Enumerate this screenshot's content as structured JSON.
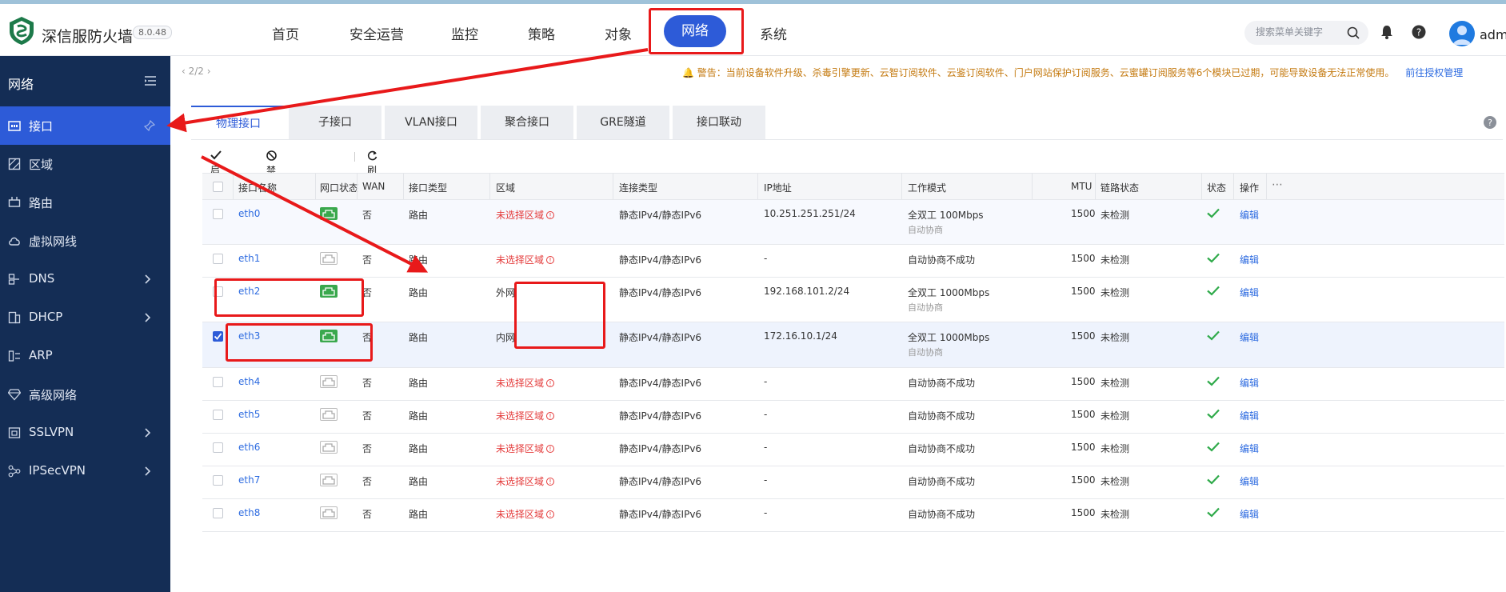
{
  "header": {
    "brand": "深信服防火墙",
    "version": "8.0.48",
    "nav": [
      "首页",
      "安全运营",
      "监控",
      "策略",
      "对象",
      "网络",
      "系统"
    ],
    "active_nav": "网络",
    "search_placeholder": "搜索菜单关键字",
    "user": "admi"
  },
  "sidebar": {
    "title": "网络",
    "items": [
      {
        "label": "接口",
        "icon": "interface-icon",
        "active": true
      },
      {
        "label": "区域",
        "icon": "zone-icon"
      },
      {
        "label": "路由",
        "icon": "route-icon"
      },
      {
        "label": "虚拟网线",
        "icon": "cloud-icon"
      },
      {
        "label": "DNS",
        "icon": "dns-icon",
        "has_children": true
      },
      {
        "label": "DHCP",
        "icon": "dhcp-icon",
        "has_children": true
      },
      {
        "label": "ARP",
        "icon": "arp-icon"
      },
      {
        "label": "高级网络",
        "icon": "diamond-icon"
      },
      {
        "label": "SSLVPN",
        "icon": "sslvpn-icon",
        "has_children": true
      },
      {
        "label": "IPSecVPN",
        "icon": "ipsec-icon",
        "has_children": true
      }
    ]
  },
  "content": {
    "pager": "2/2",
    "warning": "警告：当前设备软件升级、杀毒引擎更新、云智订阅软件、云鉴订阅软件、门户网站保护订阅服务、云蜜罐订阅服务等6个模块已过期，可能导致设备无法正常使用。",
    "warning_link": "前往授权管理",
    "tabs": [
      "物理接口",
      "子接口",
      "VLAN接口",
      "聚合接口",
      "GRE隧道",
      "接口联动"
    ],
    "toolbar": {
      "enable": "启用",
      "disable": "禁用",
      "refresh": "刷新"
    },
    "columns": [
      "接口名称",
      "网口状态",
      "WAN",
      "接口类型",
      "区域",
      "连接类型",
      "IP地址",
      "工作模式",
      "MTU",
      "链路状态",
      "状态",
      "操作"
    ],
    "edit_label": "编辑",
    "rows": [
      {
        "name": "eth0",
        "port_up": true,
        "wan": "否",
        "type": "路由",
        "zone": "未选择区域",
        "zone_unset": true,
        "conn": "静态IPv4/静态IPv6",
        "ip": "10.251.251.251/24",
        "mode": "全双工 100Mbps",
        "mode_sub": "自动协商",
        "mtu": "1500",
        "link": "未检测",
        "checked": false
      },
      {
        "name": "eth1",
        "port_up": false,
        "wan": "否",
        "type": "路由",
        "zone": "未选择区域",
        "zone_unset": true,
        "conn": "静态IPv4/静态IPv6",
        "ip": "-",
        "mode": "自动协商不成功",
        "mode_sub": "",
        "mtu": "1500",
        "link": "未检测",
        "checked": false
      },
      {
        "name": "eth2",
        "port_up": true,
        "wan": "否",
        "type": "路由",
        "zone": "外网",
        "zone_unset": false,
        "conn": "静态IPv4/静态IPv6",
        "ip": "192.168.101.2/24",
        "mode": "全双工 1000Mbps",
        "mode_sub": "自动协商",
        "mtu": "1500",
        "link": "未检测",
        "checked": false
      },
      {
        "name": "eth3",
        "port_up": true,
        "wan": "否",
        "type": "路由",
        "zone": "内网",
        "zone_unset": false,
        "conn": "静态IPv4/静态IPv6",
        "ip": "172.16.10.1/24",
        "mode": "全双工 1000Mbps",
        "mode_sub": "自动协商",
        "mtu": "1500",
        "link": "未检测",
        "checked": true
      },
      {
        "name": "eth4",
        "port_up": false,
        "wan": "否",
        "type": "路由",
        "zone": "未选择区域",
        "zone_unset": true,
        "conn": "静态IPv4/静态IPv6",
        "ip": "-",
        "mode": "自动协商不成功",
        "mode_sub": "",
        "mtu": "1500",
        "link": "未检测",
        "checked": false
      },
      {
        "name": "eth5",
        "port_up": false,
        "wan": "否",
        "type": "路由",
        "zone": "未选择区域",
        "zone_unset": true,
        "conn": "静态IPv4/静态IPv6",
        "ip": "-",
        "mode": "自动协商不成功",
        "mode_sub": "",
        "mtu": "1500",
        "link": "未检测",
        "checked": false
      },
      {
        "name": "eth6",
        "port_up": false,
        "wan": "否",
        "type": "路由",
        "zone": "未选择区域",
        "zone_unset": true,
        "conn": "静态IPv4/静态IPv6",
        "ip": "-",
        "mode": "自动协商不成功",
        "mode_sub": "",
        "mtu": "1500",
        "link": "未检测",
        "checked": false
      },
      {
        "name": "eth7",
        "port_up": false,
        "wan": "否",
        "type": "路由",
        "zone": "未选择区域",
        "zone_unset": true,
        "conn": "静态IPv4/静态IPv6",
        "ip": "-",
        "mode": "自动协商不成功",
        "mode_sub": "",
        "mtu": "1500",
        "link": "未检测",
        "checked": false
      },
      {
        "name": "eth8",
        "port_up": false,
        "wan": "否",
        "type": "路由",
        "zone": "未选择区域",
        "zone_unset": true,
        "conn": "静态IPv4/静态IPv6",
        "ip": "-",
        "mode": "自动协商不成功",
        "mode_sub": "",
        "mtu": "1500",
        "link": "未检测",
        "checked": false
      }
    ]
  },
  "colors": {
    "accent": "#2d5bd8",
    "sidebar": "#142d55",
    "annotation": "#e8191a",
    "status_ok": "#2faa4a",
    "zone_warn": "#e43b3b"
  }
}
